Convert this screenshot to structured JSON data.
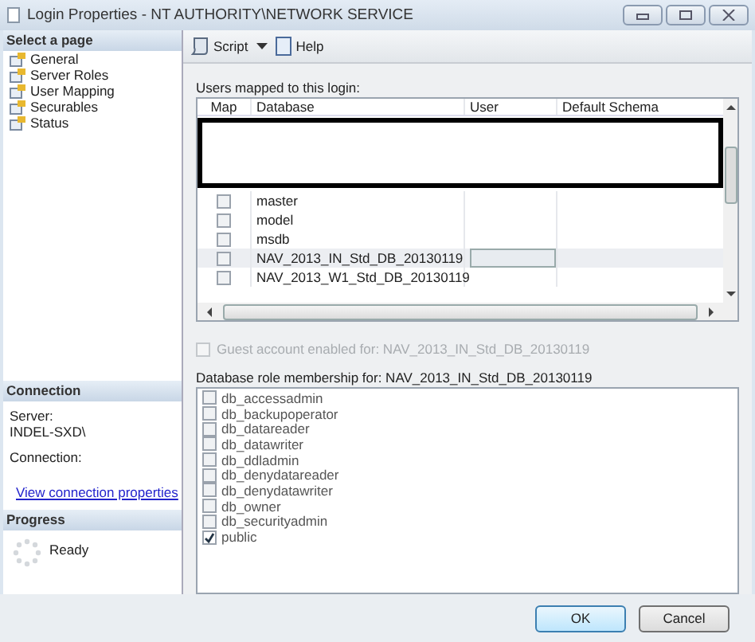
{
  "window": {
    "title": "Login Properties - NT AUTHORITY\\NETWORK SERVICE"
  },
  "sidebar": {
    "header": "Select a page",
    "items": [
      {
        "label": "General"
      },
      {
        "label": "Server Roles"
      },
      {
        "label": "User Mapping"
      },
      {
        "label": "Securables"
      },
      {
        "label": "Status"
      }
    ]
  },
  "connection": {
    "header": "Connection",
    "server_label": "Server:",
    "server": "INDEL-SXD\\",
    "connection_label": "Connection:",
    "link": "View connection properties"
  },
  "progress": {
    "header": "Progress",
    "status": "Ready"
  },
  "toolbar": {
    "script": "Script",
    "help": "Help"
  },
  "users": {
    "label": "Users mapped to this login:",
    "columns": [
      "Map",
      "Database",
      "User",
      "Default Schema"
    ],
    "rows": [
      {
        "map": false,
        "database": "master",
        "selected": false
      },
      {
        "map": false,
        "database": "model",
        "selected": false
      },
      {
        "map": false,
        "database": "msdb",
        "selected": false
      },
      {
        "map": false,
        "database": "NAV_2013_IN_Std_DB_20130119",
        "selected": true
      },
      {
        "map": false,
        "database": "NAV_2013_W1_Std_DB_20130119",
        "selected": false
      }
    ]
  },
  "guest": {
    "label": "Guest account enabled for: NAV_2013_IN_Std_DB_20130119",
    "checked": false,
    "disabled": true
  },
  "roles": {
    "label": "Database role membership for: NAV_2013_IN_Std_DB_20130119",
    "items": [
      {
        "label": "db_accessadmin",
        "checked": false
      },
      {
        "label": "db_backupoperator",
        "checked": false
      },
      {
        "label": "db_datareader",
        "checked": false
      },
      {
        "label": "db_datawriter",
        "checked": false
      },
      {
        "label": "db_ddladmin",
        "checked": false
      },
      {
        "label": "db_denydatareader",
        "checked": false
      },
      {
        "label": "db_denydatawriter",
        "checked": false
      },
      {
        "label": "db_owner",
        "checked": false
      },
      {
        "label": "db_securityadmin",
        "checked": false
      },
      {
        "label": "public",
        "checked": true
      }
    ]
  },
  "buttons": [
    {
      "label": "OK",
      "default": true
    },
    {
      "label": "Cancel",
      "default": false
    }
  ]
}
